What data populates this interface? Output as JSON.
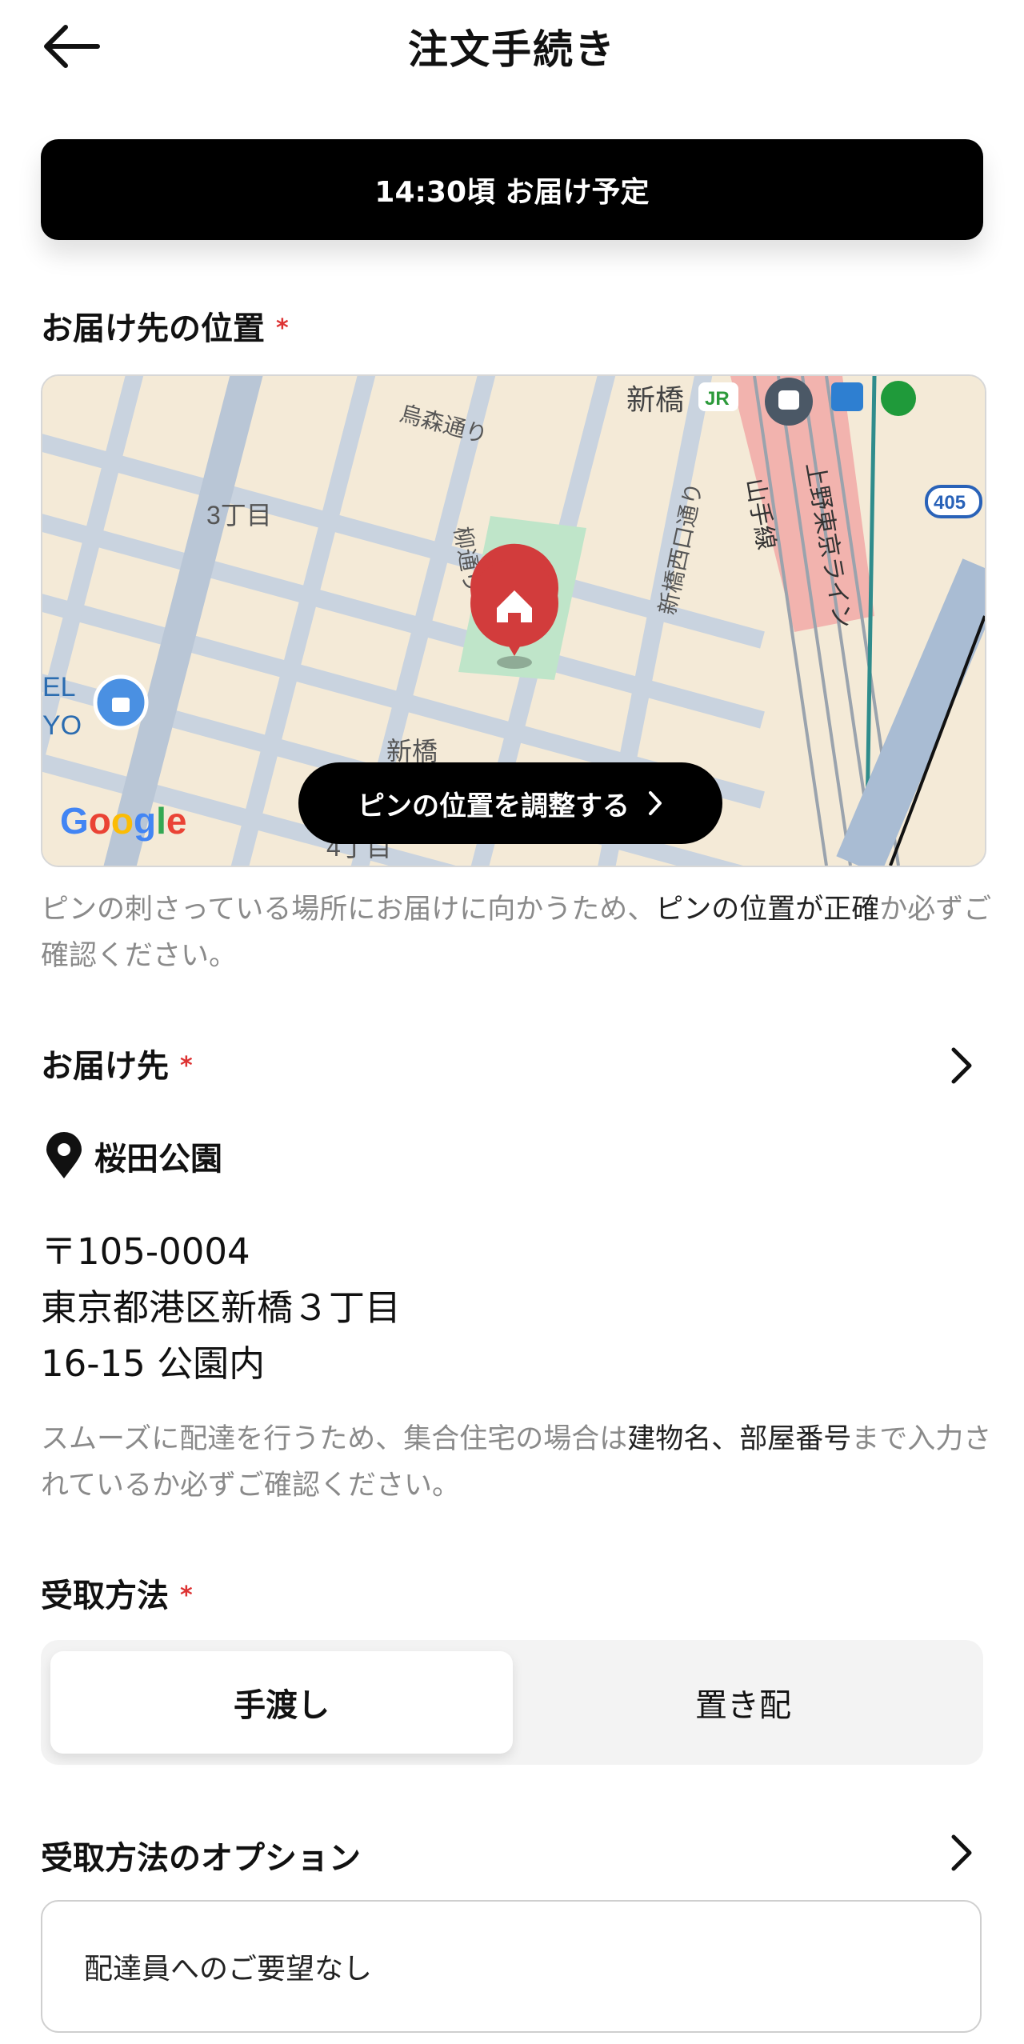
{
  "header": {
    "title": "注文手続き",
    "back_icon": "arrow-left-icon"
  },
  "eta_banner": "14:30頃 お届け予定",
  "location": {
    "title": "お届け先の位置",
    "required_mark": "*",
    "map": {
      "labels": [
        "烏森通り",
        "3丁目",
        "新橋",
        "柳通り",
        "新橋西口通り",
        "山手線",
        "上野東京ライン",
        "405",
        "4丁目",
        "EL",
        "YO"
      ],
      "provider": "Google"
    },
    "adjust_button": "ピンの位置を調整する",
    "note_prefix": "ピンの刺さっている場所にお届けに向かうため、",
    "note_highlight": "ピンの位置が正確",
    "note_suffix": "か必ずご確認ください。"
  },
  "destination": {
    "title": "お届け先",
    "required_mark": "*",
    "place_name": "桜田公園",
    "postal": "〒105-0004",
    "address_line1": "東京都港区新橋３丁目",
    "address_line2": "16-15 公園内",
    "note_prefix": "スムーズに配達を行うため、集合住宅の場合は",
    "note_highlight": "建物名、部屋番号",
    "note_suffix": "まで入力されているか必ずご確認ください。"
  },
  "receive_method": {
    "title": "受取方法",
    "required_mark": "*",
    "options": [
      "手渡し",
      "置き配"
    ],
    "selected": "手渡し"
  },
  "receive_options": {
    "title": "受取方法のオプション",
    "value": "配達員へのご要望なし"
  },
  "colors": {
    "accent_black": "#000000",
    "required_red": "#d33333",
    "pin_red": "#d23c3c"
  }
}
